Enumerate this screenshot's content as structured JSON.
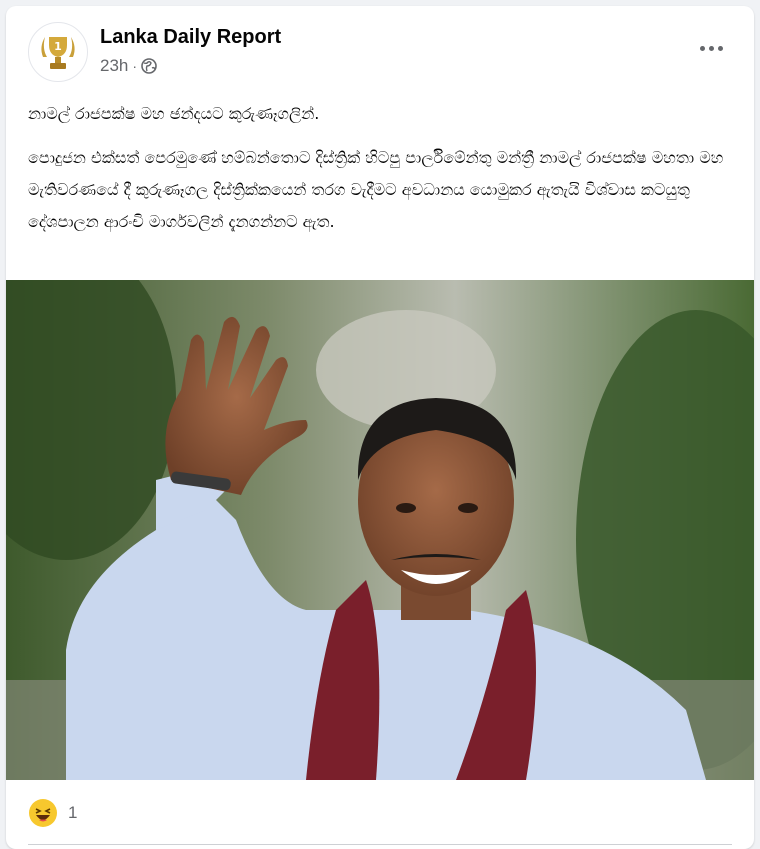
{
  "post": {
    "page_name": "Lanka Daily Report",
    "time": "23h",
    "separator": "·",
    "privacy_icon": "globe-icon",
    "menu_icon": "more-horizontal-icon",
    "headline": "නාමල් රාජපක්ෂ මහ ඡන්දයට කුරුණෑගලින්.",
    "body": "පොදුජන එක්සත් පෙරමුණේ හම්බන්තොට දිස්ත්‍රික් හිටපු පාර්ලිමේන්තු මන්ත්‍රී නාමල් රාජපක්ෂ මහතා මහ මැතිවරණයේ දී කුරුණෑගල දිස්ත්‍රික්කයෙන් තරග වැදීමට අවධානය යොමුකර ඇතැයි විශ්වාස කටයුතු දේශපාලන ආරංචි මාර්ගවලින් දැනගන්නට ඇත."
  },
  "reactions": {
    "emoji_icon": "haha-reaction-icon",
    "count": "1"
  },
  "colors": {
    "card_bg": "#ffffff",
    "page_bg": "#f0f2f5",
    "text_primary": "#050505",
    "text_secondary": "#65676b",
    "scarf": "#7a1f2b",
    "shirt": "#c9d7ee"
  }
}
